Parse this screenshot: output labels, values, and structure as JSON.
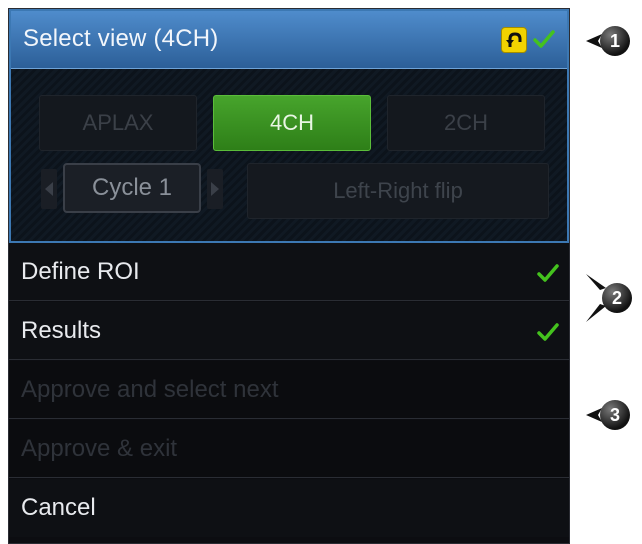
{
  "select_view": {
    "title": "Select view (4CH)",
    "undo_icon": "undo-arrow-icon",
    "views": [
      {
        "label": "APLAX",
        "active": false
      },
      {
        "label": "4CH",
        "active": true
      },
      {
        "label": "2CH",
        "active": false
      }
    ],
    "cycle_label": "Cycle 1",
    "flip_label": "Left-Right flip"
  },
  "steps": [
    {
      "label": "Define ROI",
      "done": true
    },
    {
      "label": "Results",
      "done": true
    }
  ],
  "actions": [
    {
      "label": "Approve and select next",
      "enabled": false
    },
    {
      "label": "Approve & exit",
      "enabled": false
    },
    {
      "label": "Cancel",
      "enabled": true
    }
  ],
  "callouts": [
    "1",
    "2",
    "3"
  ],
  "colors": {
    "accent_blue": "#3c78b3",
    "active_green": "#3a9a22",
    "check_green": "#44c21e",
    "undo_yellow": "#f2d300"
  }
}
